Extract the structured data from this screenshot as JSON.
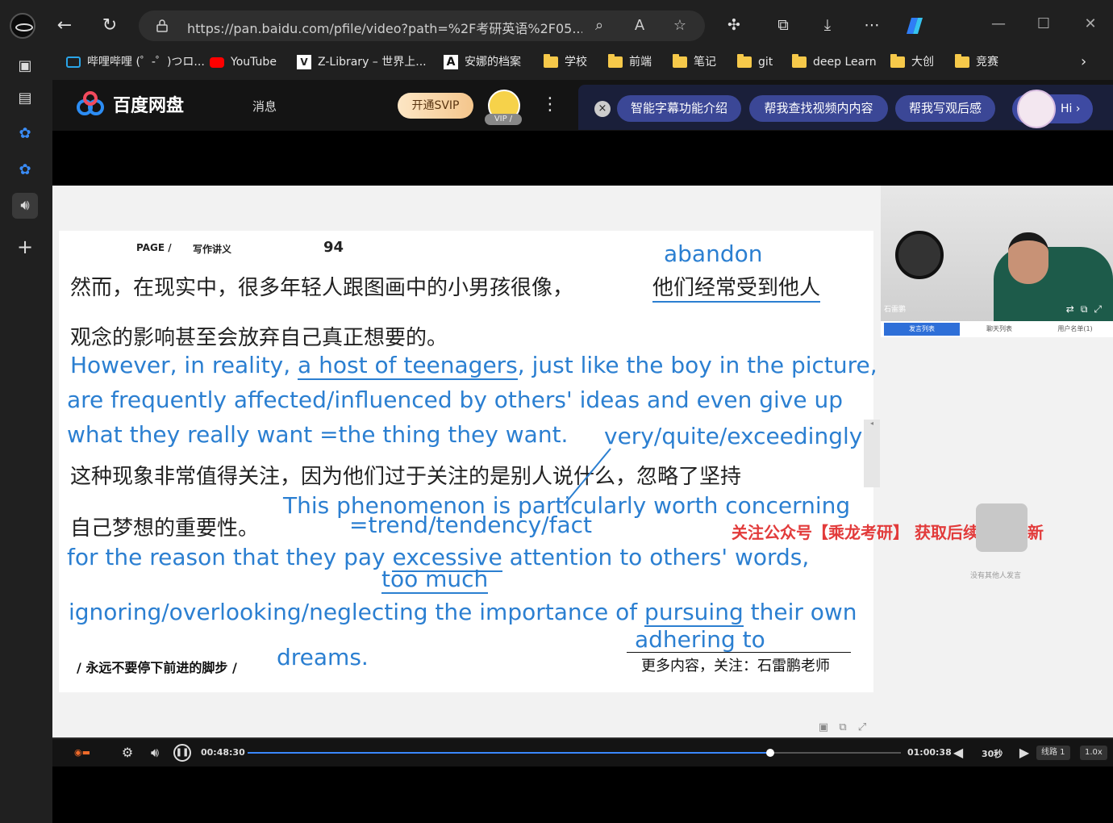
{
  "browser": {
    "url": "https://pan.baidu.com/pfile/video?path=%2F考研英语%2F05....",
    "bookmarks": [
      {
        "label": "哔哩哔哩 (゜-゜)つロ...",
        "icon": "bilibili-icon"
      },
      {
        "label": "YouTube",
        "icon": "youtube-icon"
      },
      {
        "label": "Z-Library – 世界上...",
        "icon": "zlibrary-icon"
      },
      {
        "label": "安娜的档案",
        "icon": "annas-archive-icon"
      },
      {
        "label": "学校",
        "icon": "folder-icon"
      },
      {
        "label": "前端",
        "icon": "folder-icon"
      },
      {
        "label": "笔记",
        "icon": "folder-icon"
      },
      {
        "label": "git",
        "icon": "folder-icon"
      },
      {
        "label": "deep Learn",
        "icon": "folder-icon"
      },
      {
        "label": "大创",
        "icon": "folder-icon"
      },
      {
        "label": "竞赛",
        "icon": "folder-icon"
      }
    ]
  },
  "pan": {
    "logo_text": "百度网盘",
    "message_label": "消息",
    "svip_label": "开通SVIP",
    "vip_tag": "VIP /",
    "ai_chips": [
      "智能字幕功能介绍",
      "帮我查找视频内内容",
      "帮我写观后感"
    ],
    "hi_label": "Hi ›"
  },
  "slide": {
    "page_label": "PAGE /",
    "section": "写作讲义",
    "page_no": "94",
    "zh1a": "然而，在现实中，很多年轻人跟图画中的小男孩很像，",
    "zh1b": "他们经常受到他人",
    "zh2": "观念的影响甚至会放弃自己真正想要的。",
    "zh3": "这种现象非常值得关注，因为他们过于关注的是别人说什么，忽略了坚持",
    "zh4": "自己梦想的重要性。",
    "en_abandon": "abandon",
    "en1a": "However, in reality, ",
    "en1b": "a host of teenagers",
    "en1c": ", just like the boy in the picture,",
    "en2": "are frequently affected/influenced by others' ideas and even give up",
    "en3": "what they really want =the thing they want.",
    "en_very": "very/quite/exceedingly",
    "en4": "This phenomenon is particularly worth concerning",
    "en5": "=trend/tendency/fact",
    "en6a": "for the reason that they pay ",
    "en6b": "excessive",
    "en6c": " attention to others' words,",
    "en7": "too much",
    "en8a": "ignoring/overlooking/neglecting the importance of ",
    "en8b": "pursuing",
    "en8c": " their own",
    "en9": "adhering to",
    "en10": "dreams.",
    "footer_left": "/ 永远不要停下前进的脚步 /",
    "footer_right": "更多内容，关注：石雷鹏老师"
  },
  "overlay": {
    "promo": "关注公众号【乘龙考研】 获取后续课程更新",
    "cam_name": "石雷鹏",
    "chat_tabs": [
      "发言列表",
      "聊天列表",
      "用户名单(1)"
    ],
    "chat_empty": "没有其他人发言"
  },
  "player": {
    "current_time": "00:48:30",
    "total_time": "01:00:38",
    "progress_fraction": 0.8,
    "skip": "30秒",
    "route": "线路 1",
    "speed": "1.0x"
  }
}
